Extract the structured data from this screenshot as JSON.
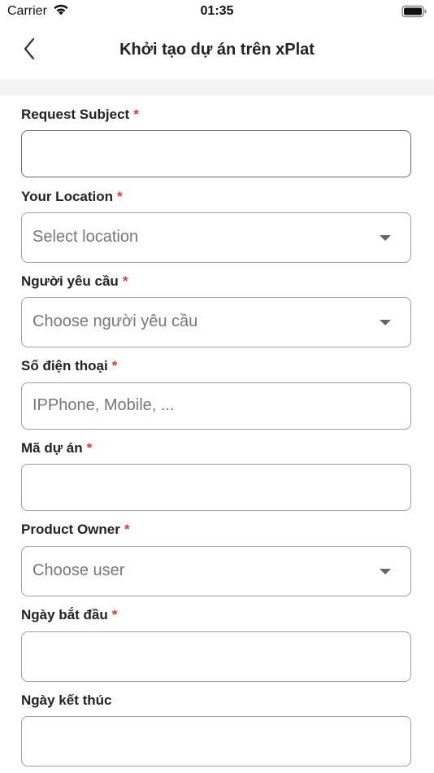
{
  "status_bar": {
    "carrier": "Carrier",
    "time": "01:35",
    "wifi_icon": "wifi-icon",
    "battery_icon": "battery-icon"
  },
  "nav": {
    "title": "Khởi tạo dự án trên xPlat",
    "back_icon": "chevron-left-icon"
  },
  "colors": {
    "required": "#e53935",
    "border": "#9e9e9e",
    "placeholder": "#777777",
    "band": "#f3f3f3"
  },
  "fields": [
    {
      "label": "Request Subject",
      "required": "*",
      "type": "text",
      "value": "",
      "placeholder": ""
    },
    {
      "label": "Your Location",
      "required": "*",
      "type": "select",
      "placeholder": "Select location"
    },
    {
      "label": "Người yêu cầu",
      "required": "*",
      "type": "select",
      "placeholder": "Choose người yêu cầu"
    },
    {
      "label": "Số điện thoại",
      "required": "*",
      "type": "text",
      "value": "",
      "placeholder": "IPPhone, Mobile, ..."
    },
    {
      "label": "Mã dự án",
      "required": "*",
      "type": "text",
      "value": "",
      "placeholder": ""
    },
    {
      "label": "Product Owner",
      "required": "*",
      "type": "select",
      "placeholder": "Choose user"
    },
    {
      "label": "Ngày bắt đầu",
      "required": "*",
      "type": "date",
      "value": ""
    },
    {
      "label": "Ngày kết thúc",
      "type": "date",
      "value": ""
    }
  ]
}
